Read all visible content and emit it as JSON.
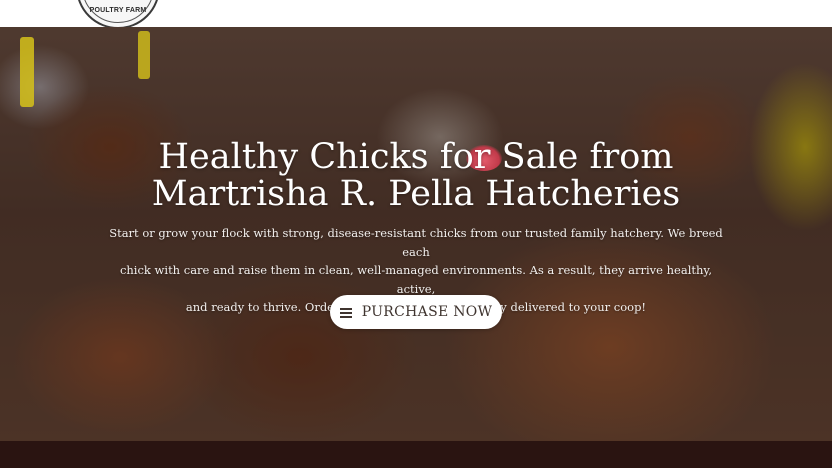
{
  "header": {
    "logo_text": "POULTRY FARM"
  },
  "hero": {
    "title_line1": "Healthy Chicks for Sale from",
    "title_line2": "Martrisha R. Pella Hatcheries",
    "description_line1": "Start or grow your flock with strong, disease-resistant chicks from our trusted family hatchery. We breed each",
    "description_line2": "chick with care and raise them in clean, well-managed environments. As a result, they arrive healthy, active,",
    "description_line3": "and ready to thrive. Order now and get reliable quality delivered to your coop!",
    "cta_label": "PURCHASE NOW",
    "cta_icon": "menu-icon",
    "background_image": "chickens-photo"
  },
  "colors": {
    "footer_band": "#2a1411",
    "cta_text": "#3f342f",
    "hero_text": "#ffffff"
  }
}
